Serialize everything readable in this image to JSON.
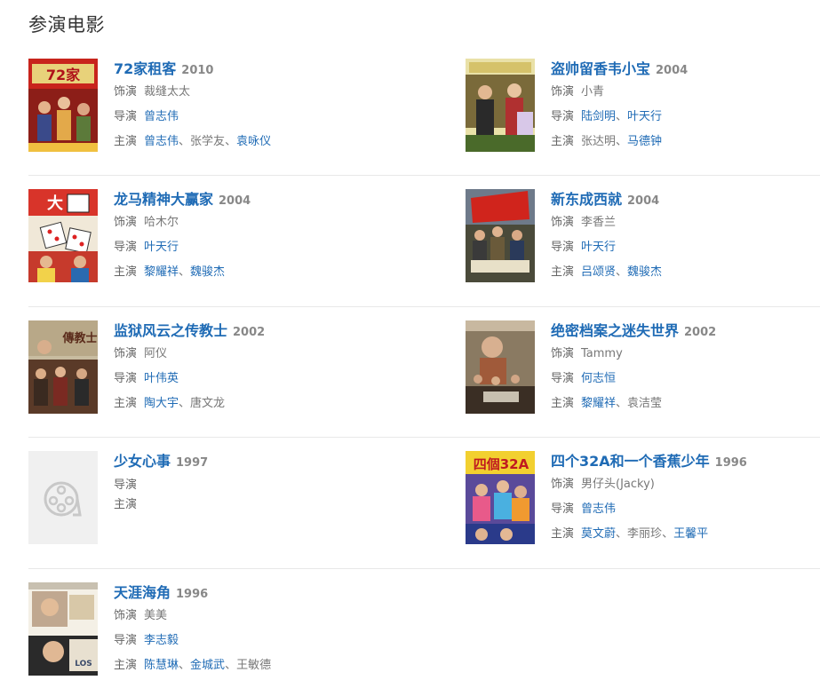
{
  "section_title": "参演电影",
  "labels": {
    "role": "饰演",
    "director": "导演",
    "cast": "主演",
    "sep": "、"
  },
  "films": [
    {
      "title": "72家租客",
      "year": "2010",
      "role": "裁缝太太",
      "director": [
        "曾志伟"
      ],
      "cast": [
        "曾志伟",
        "张学友",
        "袁咏仪"
      ],
      "poster_icon": "poster-72-tenants"
    },
    {
      "title": "盗帅留香韦小宝",
      "year": "2004",
      "role": "小青",
      "director": [
        "陆剑明",
        "叶天行"
      ],
      "cast": [
        "张达明",
        "马德钟"
      ],
      "poster_icon": "poster-thief"
    },
    {
      "title": "龙马精神大赢家",
      "year": "2004",
      "role": "哈木尔",
      "director": [
        "叶天行"
      ],
      "cast": [
        "黎耀祥",
        "魏骏杰"
      ],
      "poster_icon": "poster-dice"
    },
    {
      "title": "新东成西就",
      "year": "2004",
      "role": "李香兰",
      "director": [
        "叶天行"
      ],
      "cast": [
        "吕颂贤",
        "魏骏杰"
      ],
      "poster_icon": "poster-flag"
    },
    {
      "title": "监狱风云之传教士",
      "year": "2002",
      "role": "阿仪",
      "director": [
        "叶伟英"
      ],
      "cast": [
        "陶大宇",
        "唐文龙"
      ],
      "poster_icon": "poster-prison"
    },
    {
      "title": "绝密档案之迷失世界",
      "year": "2002",
      "role": "Tammy",
      "director": [
        "何志恒"
      ],
      "cast": [
        "黎耀祥",
        "袁洁莹"
      ],
      "poster_icon": "poster-lost-world"
    },
    {
      "title": "少女心事",
      "year": "1997",
      "role": "",
      "director": [],
      "cast": [],
      "poster_icon": "film-reel-placeholder-icon"
    },
    {
      "title": "四个32A和一个香蕉少年",
      "year": "1996",
      "role": "男仔头(Jacky)",
      "director": [
        "曾志伟"
      ],
      "cast": [
        "莫文蔚",
        "李丽珍",
        "王馨平"
      ],
      "poster_icon": "poster-32a"
    },
    {
      "title": "天涯海角",
      "year": "1996",
      "role": "美美",
      "director": [
        "李志毅"
      ],
      "cast": [
        "陈慧琳",
        "金城武",
        "王敏德"
      ],
      "poster_icon": "poster-lost-and-found"
    }
  ],
  "unlinked_names": [
    "张学友",
    "张达明",
    "唐文龙",
    "袁洁莹",
    "李丽珍",
    "王敏德"
  ],
  "colors": {
    "link": "#1f6bb5",
    "year": "#888888",
    "label": "#666666",
    "divider": "#e8e8e8",
    "placeholder_bg": "#f0f0f0"
  }
}
